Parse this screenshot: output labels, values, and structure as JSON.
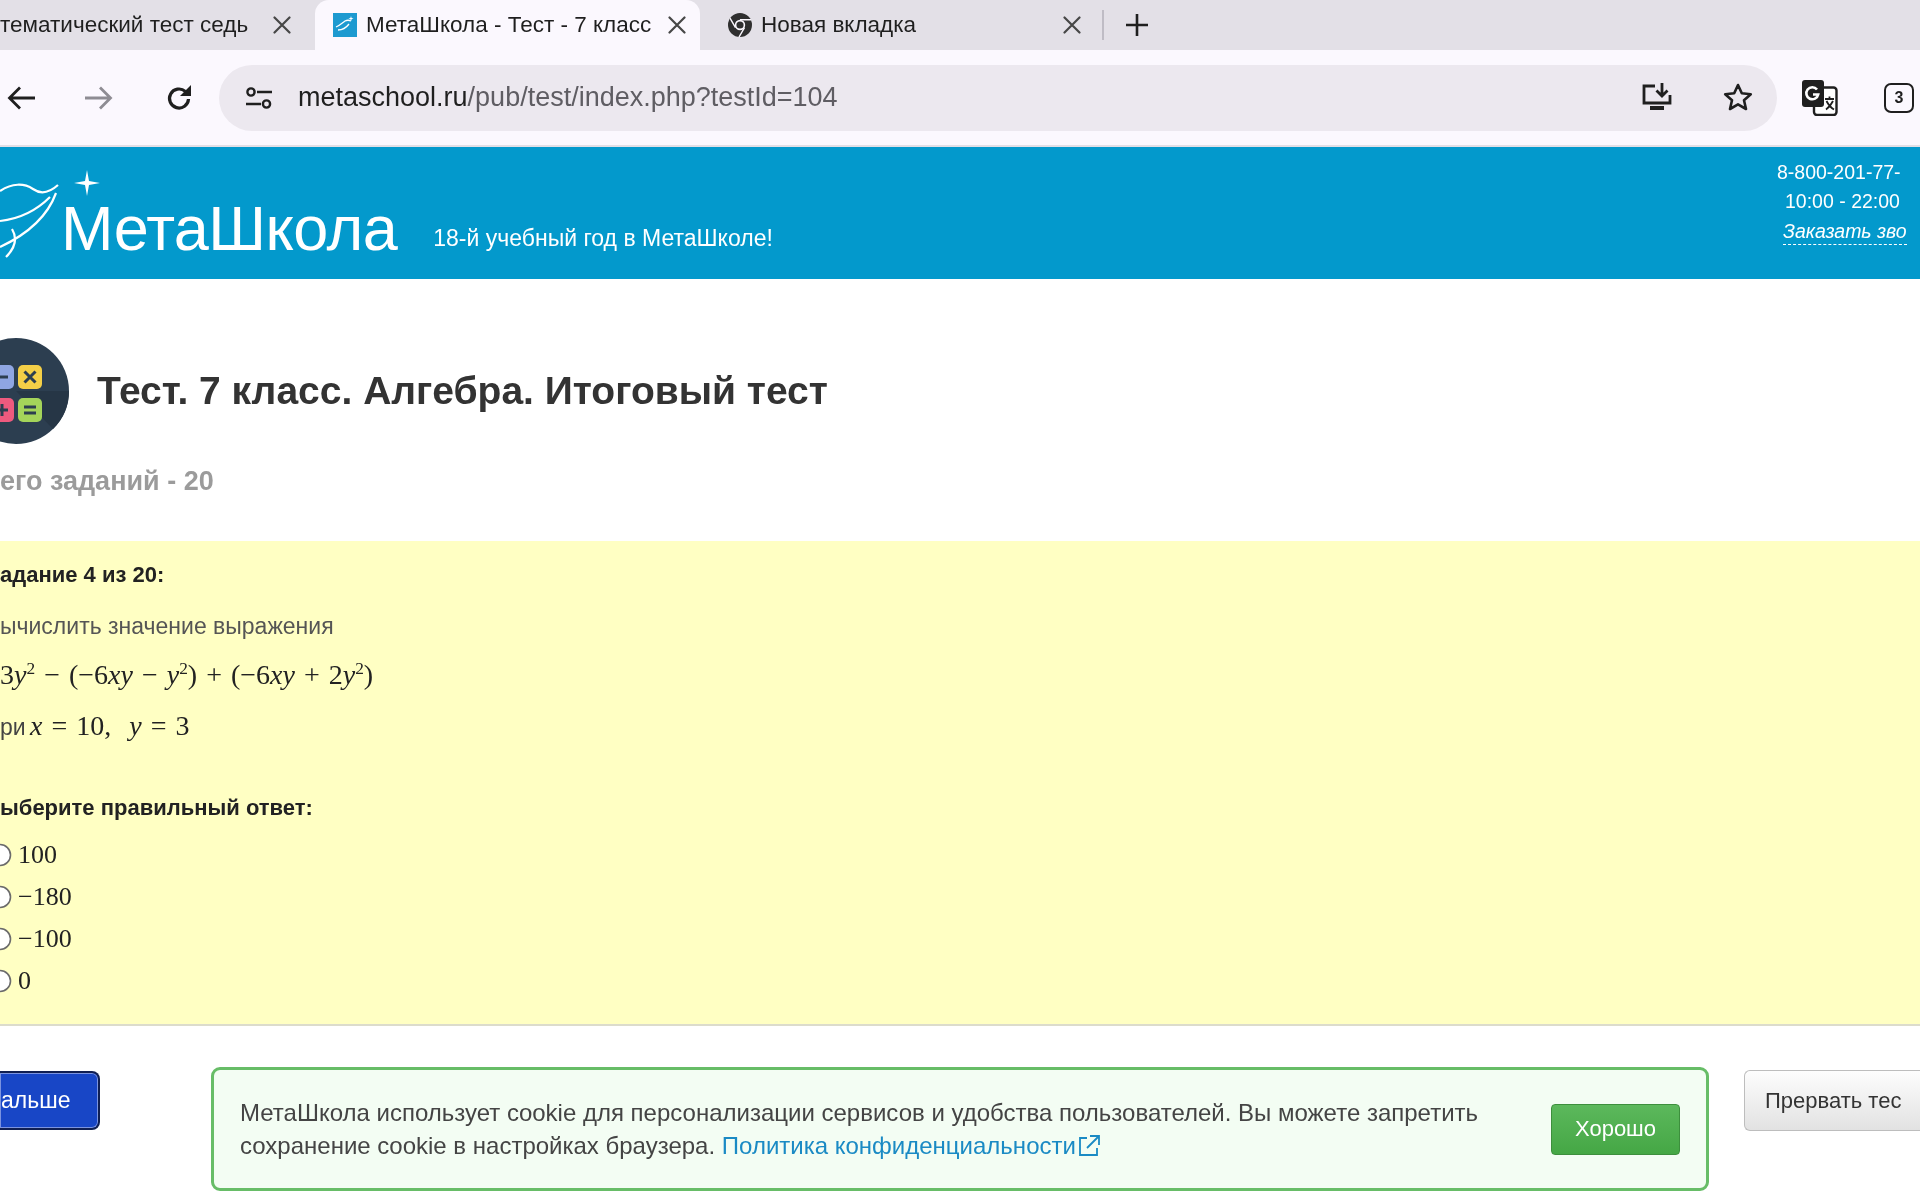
{
  "browser": {
    "tabs": [
      {
        "kind": "clipped",
        "title": "тематический тест седь",
        "selected": false
      },
      {
        "kind": "site",
        "title": "МетаШкола - Тест - 7 класс",
        "selected": true
      },
      {
        "kind": "blank",
        "title": "Новая вкладка",
        "selected": false
      }
    ],
    "address": {
      "host": "metaschool.ru",
      "path": "/pub/test/index.php?testId=104"
    },
    "tab_count": "3"
  },
  "header": {
    "logo": "МетаШкола",
    "tagline": "18-й учебный год в МетаШколе!",
    "phone": "8-800-201-77-",
    "hours": "10:00 - 22:00",
    "callback_link": "Заказать зво"
  },
  "test": {
    "title": "Тест. 7 класс. Алгебра. Итоговый тест",
    "task_total": "его заданий - 20"
  },
  "question": {
    "heading": "адание 4 из 20:",
    "prompt": "ычислить значение выражения",
    "expression": "3y$^{2}$ − (−6xy − y$^{2}$) + (−6xy + 2y$^{2}$)",
    "condition": {
      "prefix": "ри",
      "formula": "x = 10,  y = 3"
    },
    "answer_prompt": "ыберите правильный ответ:",
    "options": [
      {
        "label": "100",
        "selected": false
      },
      {
        "label": "−180",
        "selected": false
      },
      {
        "label": "−100",
        "selected": false
      },
      {
        "label": "0",
        "selected": false
      }
    ]
  },
  "buttons": {
    "next": "альше",
    "abort": "Прервать тес"
  },
  "cookie_notice": {
    "text": "МетаШкола использует cookie для персонализации сервисов и удобства пользователей. Вы можете запретить сохранение cookie в настройках браузера.",
    "link": "Политика конфиденциальности",
    "button": "Хорошо"
  }
}
